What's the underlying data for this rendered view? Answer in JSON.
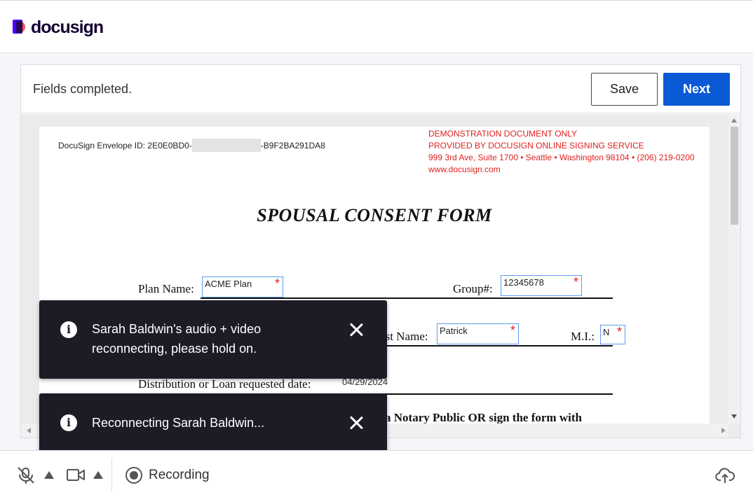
{
  "app": {
    "logo_text": "docusign"
  },
  "header": {
    "status_text": "Fields completed.",
    "save_label": "Save",
    "next_label": "Next"
  },
  "document": {
    "envelope_prefix": "DocuSign Envelope ID: 2E0E0BD0-",
    "envelope_suffix": "-B9F2BA291DA8",
    "demo_lines": [
      "DEMONSTRATION DOCUMENT ONLY",
      "PROVIDED BY DOCUSIGN ONLINE SIGNING SERVICE",
      "999 3rd Ave, Suite 1700  • Seattle • Washington 98104 • (206) 219-0200",
      "www.docusign.com"
    ],
    "title": "SPOUSAL CONSENT FORM",
    "labels": {
      "plan_name": "Plan Name:",
      "group": "Group#:",
      "first_name": "rst Name:",
      "mi": "M.I.:",
      "distribution_date": "Distribution  or Loan requested date:",
      "notary_text": "a Notary Public OR sign the form with"
    },
    "fields": {
      "plan_name": "ACME Plan",
      "group": "12345678",
      "first_name": "Patrick",
      "mi": "N",
      "distribution_date": "04/29/2024"
    },
    "required_marker": "*"
  },
  "toasts": [
    {
      "icon": "info-icon",
      "message_line1": "Sarah Baldwin's audio + video",
      "message_line2": "reconnecting, please hold on."
    },
    {
      "icon": "info-icon",
      "message_line1": "Reconnecting Sarah Baldwin..."
    }
  ],
  "bottombar": {
    "recording_label": "Recording"
  }
}
